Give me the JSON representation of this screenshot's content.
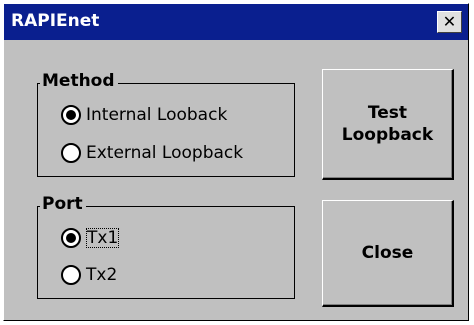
{
  "window": {
    "title": "RAPIEnet",
    "close_glyph": "✕"
  },
  "method": {
    "legend": "Method",
    "options": [
      {
        "label": "Internal Looback",
        "selected": true
      },
      {
        "label": "External Loopback",
        "selected": false
      }
    ]
  },
  "port": {
    "legend": "Port",
    "options": [
      {
        "label": "Tx1",
        "selected": true
      },
      {
        "label": "Tx2",
        "selected": false
      }
    ]
  },
  "buttons": {
    "test_line1": "Test",
    "test_line2": "Loopback",
    "close": "Close"
  },
  "colors": {
    "titlebar": "#0a1f8f",
    "face": "#c0c0c0"
  }
}
